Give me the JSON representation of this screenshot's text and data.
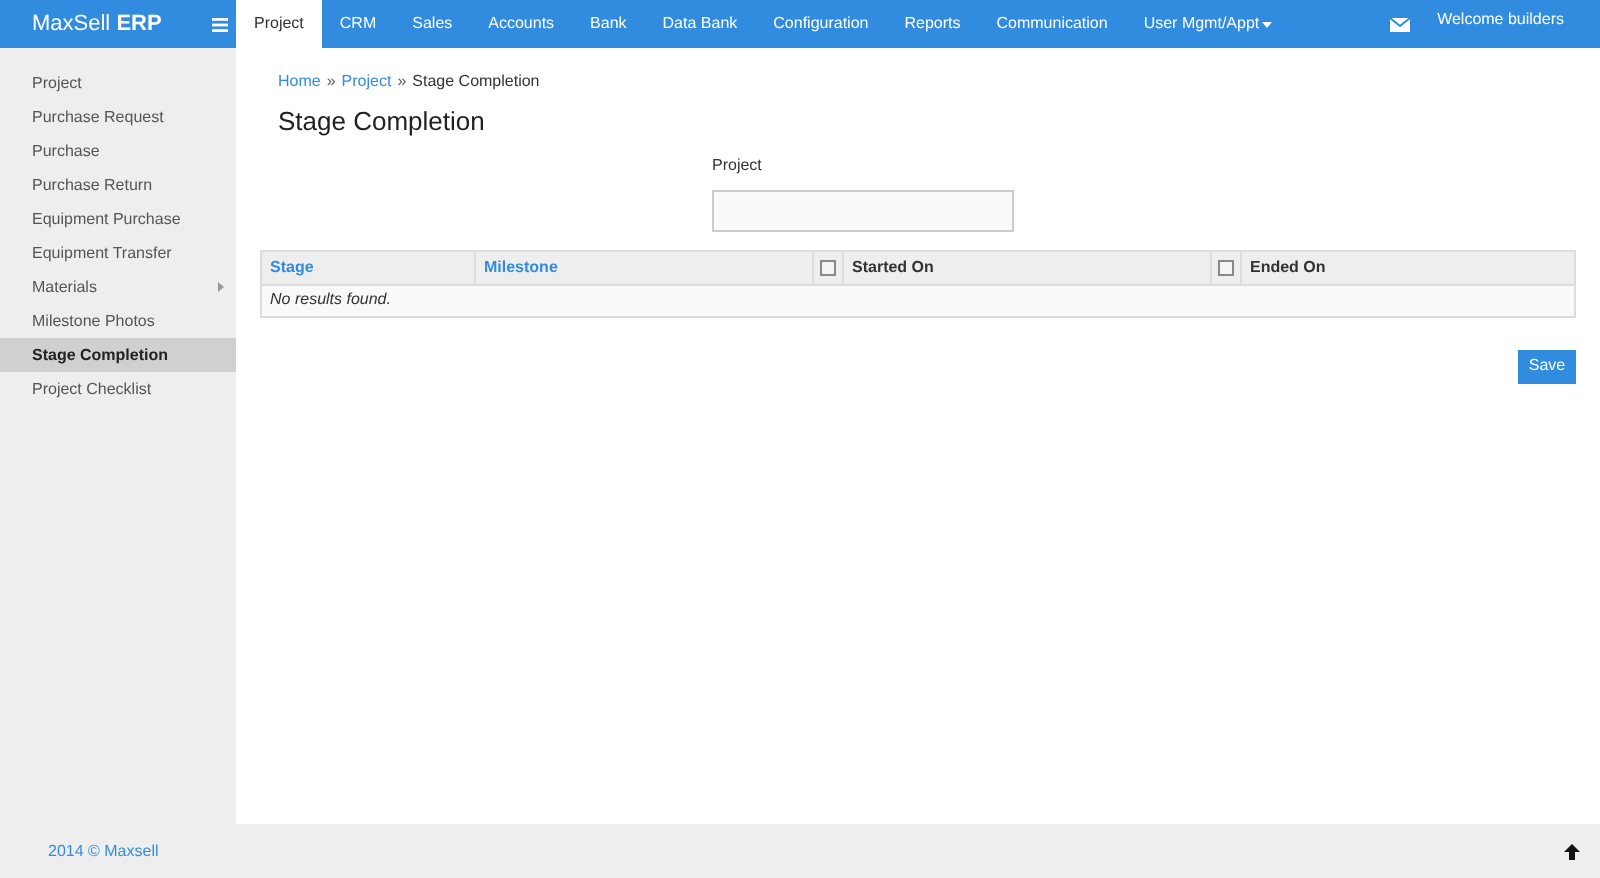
{
  "brand": "MaxSell **ERP**",
  "nav": [
    {
      "label": "Project",
      "selected": true
    },
    {
      "label": "CRM",
      "selected": false
    },
    {
      "label": "Sales",
      "selected": false
    },
    {
      "label": "Accounts",
      "selected": false
    },
    {
      "label": "Bank",
      "selected": false
    },
    {
      "label": "Data Bank",
      "selected": false
    },
    {
      "label": "Configuration",
      "selected": false
    },
    {
      "label": "Reports",
      "selected": false
    },
    {
      "label": "Communication",
      "selected": false
    },
    {
      "label": "User Mgmt/Appt",
      "selected": false,
      "dropdown": true
    }
  ],
  "welcome": "Welcome builders",
  "sidebar": {
    "items": [
      {
        "label": "Project",
        "selected": false
      },
      {
        "label": "Purchase Request",
        "selected": false
      },
      {
        "label": "Purchase",
        "selected": false
      },
      {
        "label": "Purchase Return",
        "selected": false
      },
      {
        "label": "Equipment Purchase",
        "selected": false
      },
      {
        "label": "Equipment Transfer",
        "selected": false
      },
      {
        "label": "Materials",
        "selected": false,
        "submenu": true
      },
      {
        "label": "Milestone Photos",
        "selected": false
      },
      {
        "label": "Stage Completion",
        "selected": true
      },
      {
        "label": "Project Checklist",
        "selected": false
      }
    ]
  },
  "breadcrumb": [
    {
      "label": "Home",
      "link": true
    },
    {
      "separator": "»",
      "label": "Project",
      "link": true
    },
    {
      "separator": "»",
      "label": "Stage Completion",
      "link": false
    }
  ],
  "title": "Stage Completion",
  "project_field": {
    "label": "Project"
  },
  "table": {
    "columns": [
      {
        "label": "Stage",
        "kind": "link"
      },
      {
        "label": "Milestone",
        "kind": "link"
      },
      {
        "label": "Started On",
        "kind": "checkbox",
        "checked": false
      },
      {
        "label": "Ended On",
        "kind": "checkbox",
        "checked": false
      }
    ],
    "empty": "No results found."
  },
  "save_button": "Save",
  "footer": "2014 © Maxsell"
}
